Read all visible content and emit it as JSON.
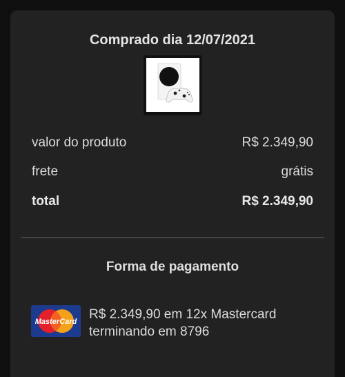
{
  "purchase": {
    "title": "Comprado dia 12/07/2021",
    "product_image": "xbox-series-s-console-icon"
  },
  "summary": {
    "product_value_label": "valor do produto",
    "product_value": "R$ 2.349,90",
    "shipping_label": "frete",
    "shipping_value": "grátis",
    "total_label": "total",
    "total_value": "R$ 2.349,90"
  },
  "payment": {
    "title": "Forma de pagamento",
    "card_brand": "MasterCard",
    "line1": "R$ 2.349,90 em 12x Mastercard",
    "line2": "terminando em 8796"
  },
  "colors": {
    "background": "#0f0f0f",
    "card": "#222222",
    "text": "#e0e0e0",
    "mastercard_red": "#e4202a",
    "mastercard_orange": "#f5a21b",
    "mastercard_blue": "#1d3b8e"
  }
}
